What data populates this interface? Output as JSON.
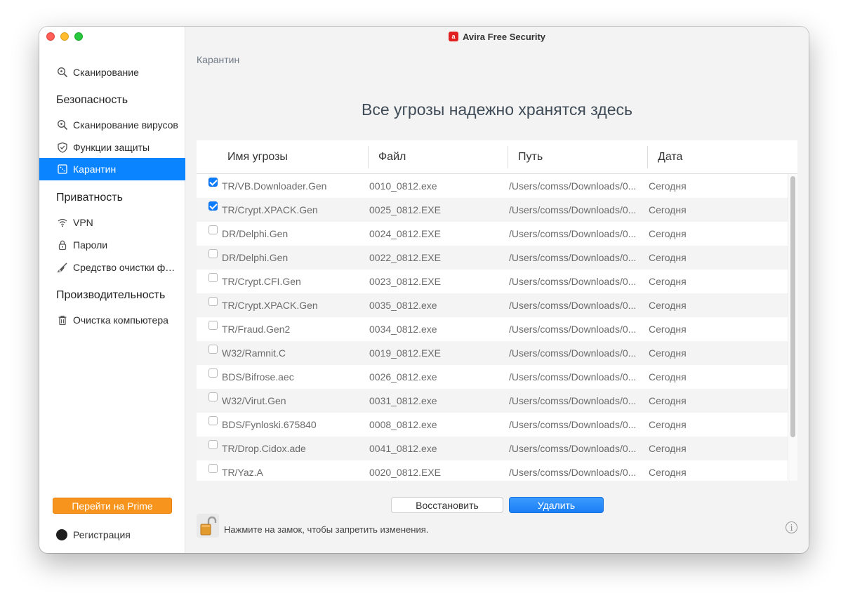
{
  "window": {
    "title": "Avira Free Security",
    "app_icon_glyph": "a"
  },
  "sidebar": {
    "scan": {
      "label": "Сканирование",
      "icon": "scan-search-icon"
    },
    "sections": {
      "security": "Безопасность",
      "privacy": "Приватность",
      "performance": "Производительность"
    },
    "security_items": [
      {
        "label": "Сканирование вирусов",
        "icon": "virus-scan-icon"
      },
      {
        "label": "Функции защиты",
        "icon": "shield-icon"
      },
      {
        "label": "Карантин",
        "icon": "quarantine-icon",
        "active": true
      }
    ],
    "privacy_items": [
      {
        "label": "VPN",
        "icon": "wifi-icon"
      },
      {
        "label": "Пароли",
        "icon": "password-lock-icon"
      },
      {
        "label": "Средство очистки файлов",
        "icon": "broom-icon"
      }
    ],
    "performance_items": [
      {
        "label": "Очистка компьютера",
        "icon": "trash-icon"
      }
    ],
    "prime_button": "Перейти на Prime",
    "registration": "Регистрация"
  },
  "main": {
    "breadcrumb": "Карантин",
    "headline": "Все угрозы надежно хранятся здесь",
    "columns": [
      "Имя угрозы",
      "Файл",
      "Путь",
      "Дата"
    ],
    "rows": [
      {
        "checked": true,
        "name": "TR/VB.Downloader.Gen",
        "file": "0010_0812.exe",
        "path": "/Users/comss/Downloads/0...",
        "date": "Сегодня"
      },
      {
        "checked": true,
        "name": "TR/Crypt.XPACK.Gen",
        "file": "0025_0812.EXE",
        "path": "/Users/comss/Downloads/0...",
        "date": "Сегодня"
      },
      {
        "checked": false,
        "name": "DR/Delphi.Gen",
        "file": "0024_0812.EXE",
        "path": "/Users/comss/Downloads/0...",
        "date": "Сегодня"
      },
      {
        "checked": false,
        "name": "DR/Delphi.Gen",
        "file": "0022_0812.EXE",
        "path": "/Users/comss/Downloads/0...",
        "date": "Сегодня"
      },
      {
        "checked": false,
        "name": "TR/Crypt.CFI.Gen",
        "file": "0023_0812.EXE",
        "path": "/Users/comss/Downloads/0...",
        "date": "Сегодня"
      },
      {
        "checked": false,
        "name": "TR/Crypt.XPACK.Gen",
        "file": "0035_0812.exe",
        "path": "/Users/comss/Downloads/0...",
        "date": "Сегодня"
      },
      {
        "checked": false,
        "name": "TR/Fraud.Gen2",
        "file": "0034_0812.exe",
        "path": "/Users/comss/Downloads/0...",
        "date": "Сегодня"
      },
      {
        "checked": false,
        "name": "W32/Ramnit.C",
        "file": "0019_0812.EXE",
        "path": "/Users/comss/Downloads/0...",
        "date": "Сегодня"
      },
      {
        "checked": false,
        "name": "BDS/Bifrose.aec",
        "file": "0026_0812.exe",
        "path": "/Users/comss/Downloads/0...",
        "date": "Сегодня"
      },
      {
        "checked": false,
        "name": "W32/Virut.Gen",
        "file": "0031_0812.exe",
        "path": "/Users/comss/Downloads/0...",
        "date": "Сегодня"
      },
      {
        "checked": false,
        "name": "BDS/Fynloski.675840",
        "file": "0008_0812.exe",
        "path": "/Users/comss/Downloads/0...",
        "date": "Сегодня"
      },
      {
        "checked": false,
        "name": "TR/Drop.Cidox.ade",
        "file": "0041_0812.exe",
        "path": "/Users/comss/Downloads/0...",
        "date": "Сегодня"
      },
      {
        "checked": false,
        "name": "TR/Yaz.A",
        "file": "0020_0812.EXE",
        "path": "/Users/comss/Downloads/0...",
        "date": "Сегодня"
      }
    ],
    "restore_button": "Восстановить",
    "delete_button": "Удалить",
    "lock_hint": "Нажмите на замок, чтобы запретить изменения.",
    "info_glyph": "i"
  },
  "colors": {
    "accent": "#0a84ff",
    "prime": "#f7941d",
    "brand": "#e02020"
  }
}
